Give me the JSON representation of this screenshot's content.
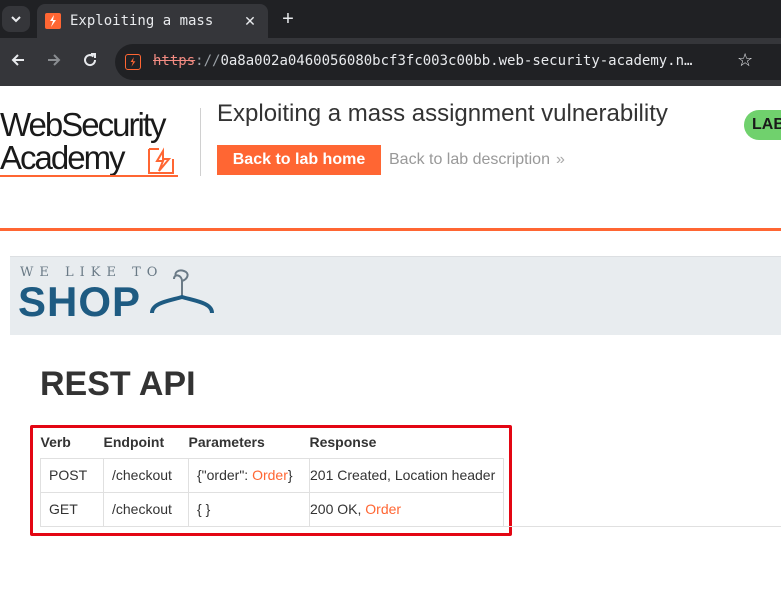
{
  "browser": {
    "tab_title": "Exploiting a mass",
    "url_scheme": "https",
    "url_sep": "://",
    "url_host": "0a8a002a0460056080bcf3fc003c00bb.web-security-academy.n…"
  },
  "header": {
    "logo_line1": "WebSecurity",
    "logo_line2": "Academy",
    "lab_title": "Exploiting a mass assignment vulnerability",
    "back_home": "Back to lab home",
    "back_desc": "Back to lab description",
    "chevron": "»",
    "lab_badge": "LAB"
  },
  "banner": {
    "tagline": "WE LIKE TO",
    "shop": "SHOP"
  },
  "main": {
    "heading": "REST API",
    "columns": [
      "Verb",
      "Endpoint",
      "Parameters",
      "Response"
    ],
    "rows": [
      {
        "verb": "POST",
        "endpoint": "/checkout",
        "param_prefix": "{\"order\": ",
        "param_link": "Order",
        "param_suffix": "}",
        "response_text": "201 Created, Location header",
        "response_link": ""
      },
      {
        "verb": "GET",
        "endpoint": "/checkout",
        "param_prefix": "{ }",
        "param_link": "",
        "param_suffix": "",
        "response_text": "200 OK, ",
        "response_link": "Order"
      }
    ]
  },
  "colors": {
    "accent": "#ff6633",
    "highlight": "#e30613",
    "shop_blue": "#1e5b82",
    "lab_green": "#70d16d"
  }
}
